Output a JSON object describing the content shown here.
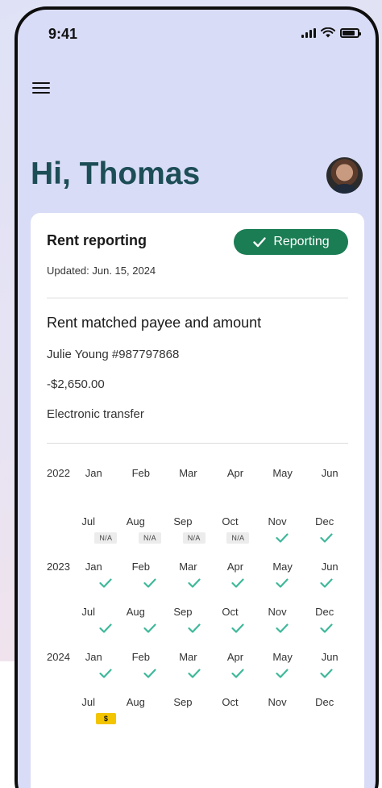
{
  "status_bar": {
    "time": "9:41"
  },
  "header": {
    "greeting": "Hi, Thomas"
  },
  "card": {
    "title": "Rent reporting",
    "status_label": "Reporting",
    "updated": "Updated: Jun. 15, 2024",
    "match_title": "Rent matched payee and amount",
    "payee": "Julie Young #987797868",
    "amount": "-$2,650.00",
    "method": "Electronic transfer"
  },
  "calendar": {
    "years": [
      {
        "year": "2022",
        "rows": [
          {
            "months": [
              "Jan",
              "Feb",
              "Mar",
              "Apr",
              "May",
              "Jun"
            ],
            "status": [
              "",
              "",
              "",
              "",
              "",
              ""
            ]
          },
          {
            "months": [
              "Jul",
              "Aug",
              "Sep",
              "Oct",
              "Nov",
              "Dec"
            ],
            "status": [
              "N/A",
              "N/A",
              "N/A",
              "N/A",
              "check",
              "check"
            ]
          }
        ]
      },
      {
        "year": "2023",
        "rows": [
          {
            "months": [
              "Jan",
              "Feb",
              "Mar",
              "Apr",
              "May",
              "Jun"
            ],
            "status": [
              "check",
              "check",
              "check",
              "check",
              "check",
              "check"
            ]
          },
          {
            "months": [
              "Jul",
              "Aug",
              "Sep",
              "Oct",
              "Nov",
              "Dec"
            ],
            "status": [
              "check",
              "check",
              "check",
              "check",
              "check",
              "check"
            ]
          }
        ]
      },
      {
        "year": "2024",
        "rows": [
          {
            "months": [
              "Jan",
              "Feb",
              "Mar",
              "Apr",
              "May",
              "Jun"
            ],
            "status": [
              "check",
              "check",
              "check",
              "check",
              "check",
              "check"
            ]
          },
          {
            "months": [
              "Jul",
              "Aug",
              "Sep",
              "Oct",
              "Nov",
              "Dec"
            ],
            "status": [
              "$",
              "",
              "",
              "",
              "",
              ""
            ]
          }
        ]
      }
    ]
  },
  "colors": {
    "accent": "#1b7d54",
    "check": "#3fb89a",
    "greeting": "#1d4d57",
    "pending": "#f2c500"
  },
  "icons": {
    "menu": "menu-icon",
    "check": "check-icon",
    "signal": "signal-icon",
    "wifi": "wifi-icon",
    "battery": "battery-icon"
  }
}
